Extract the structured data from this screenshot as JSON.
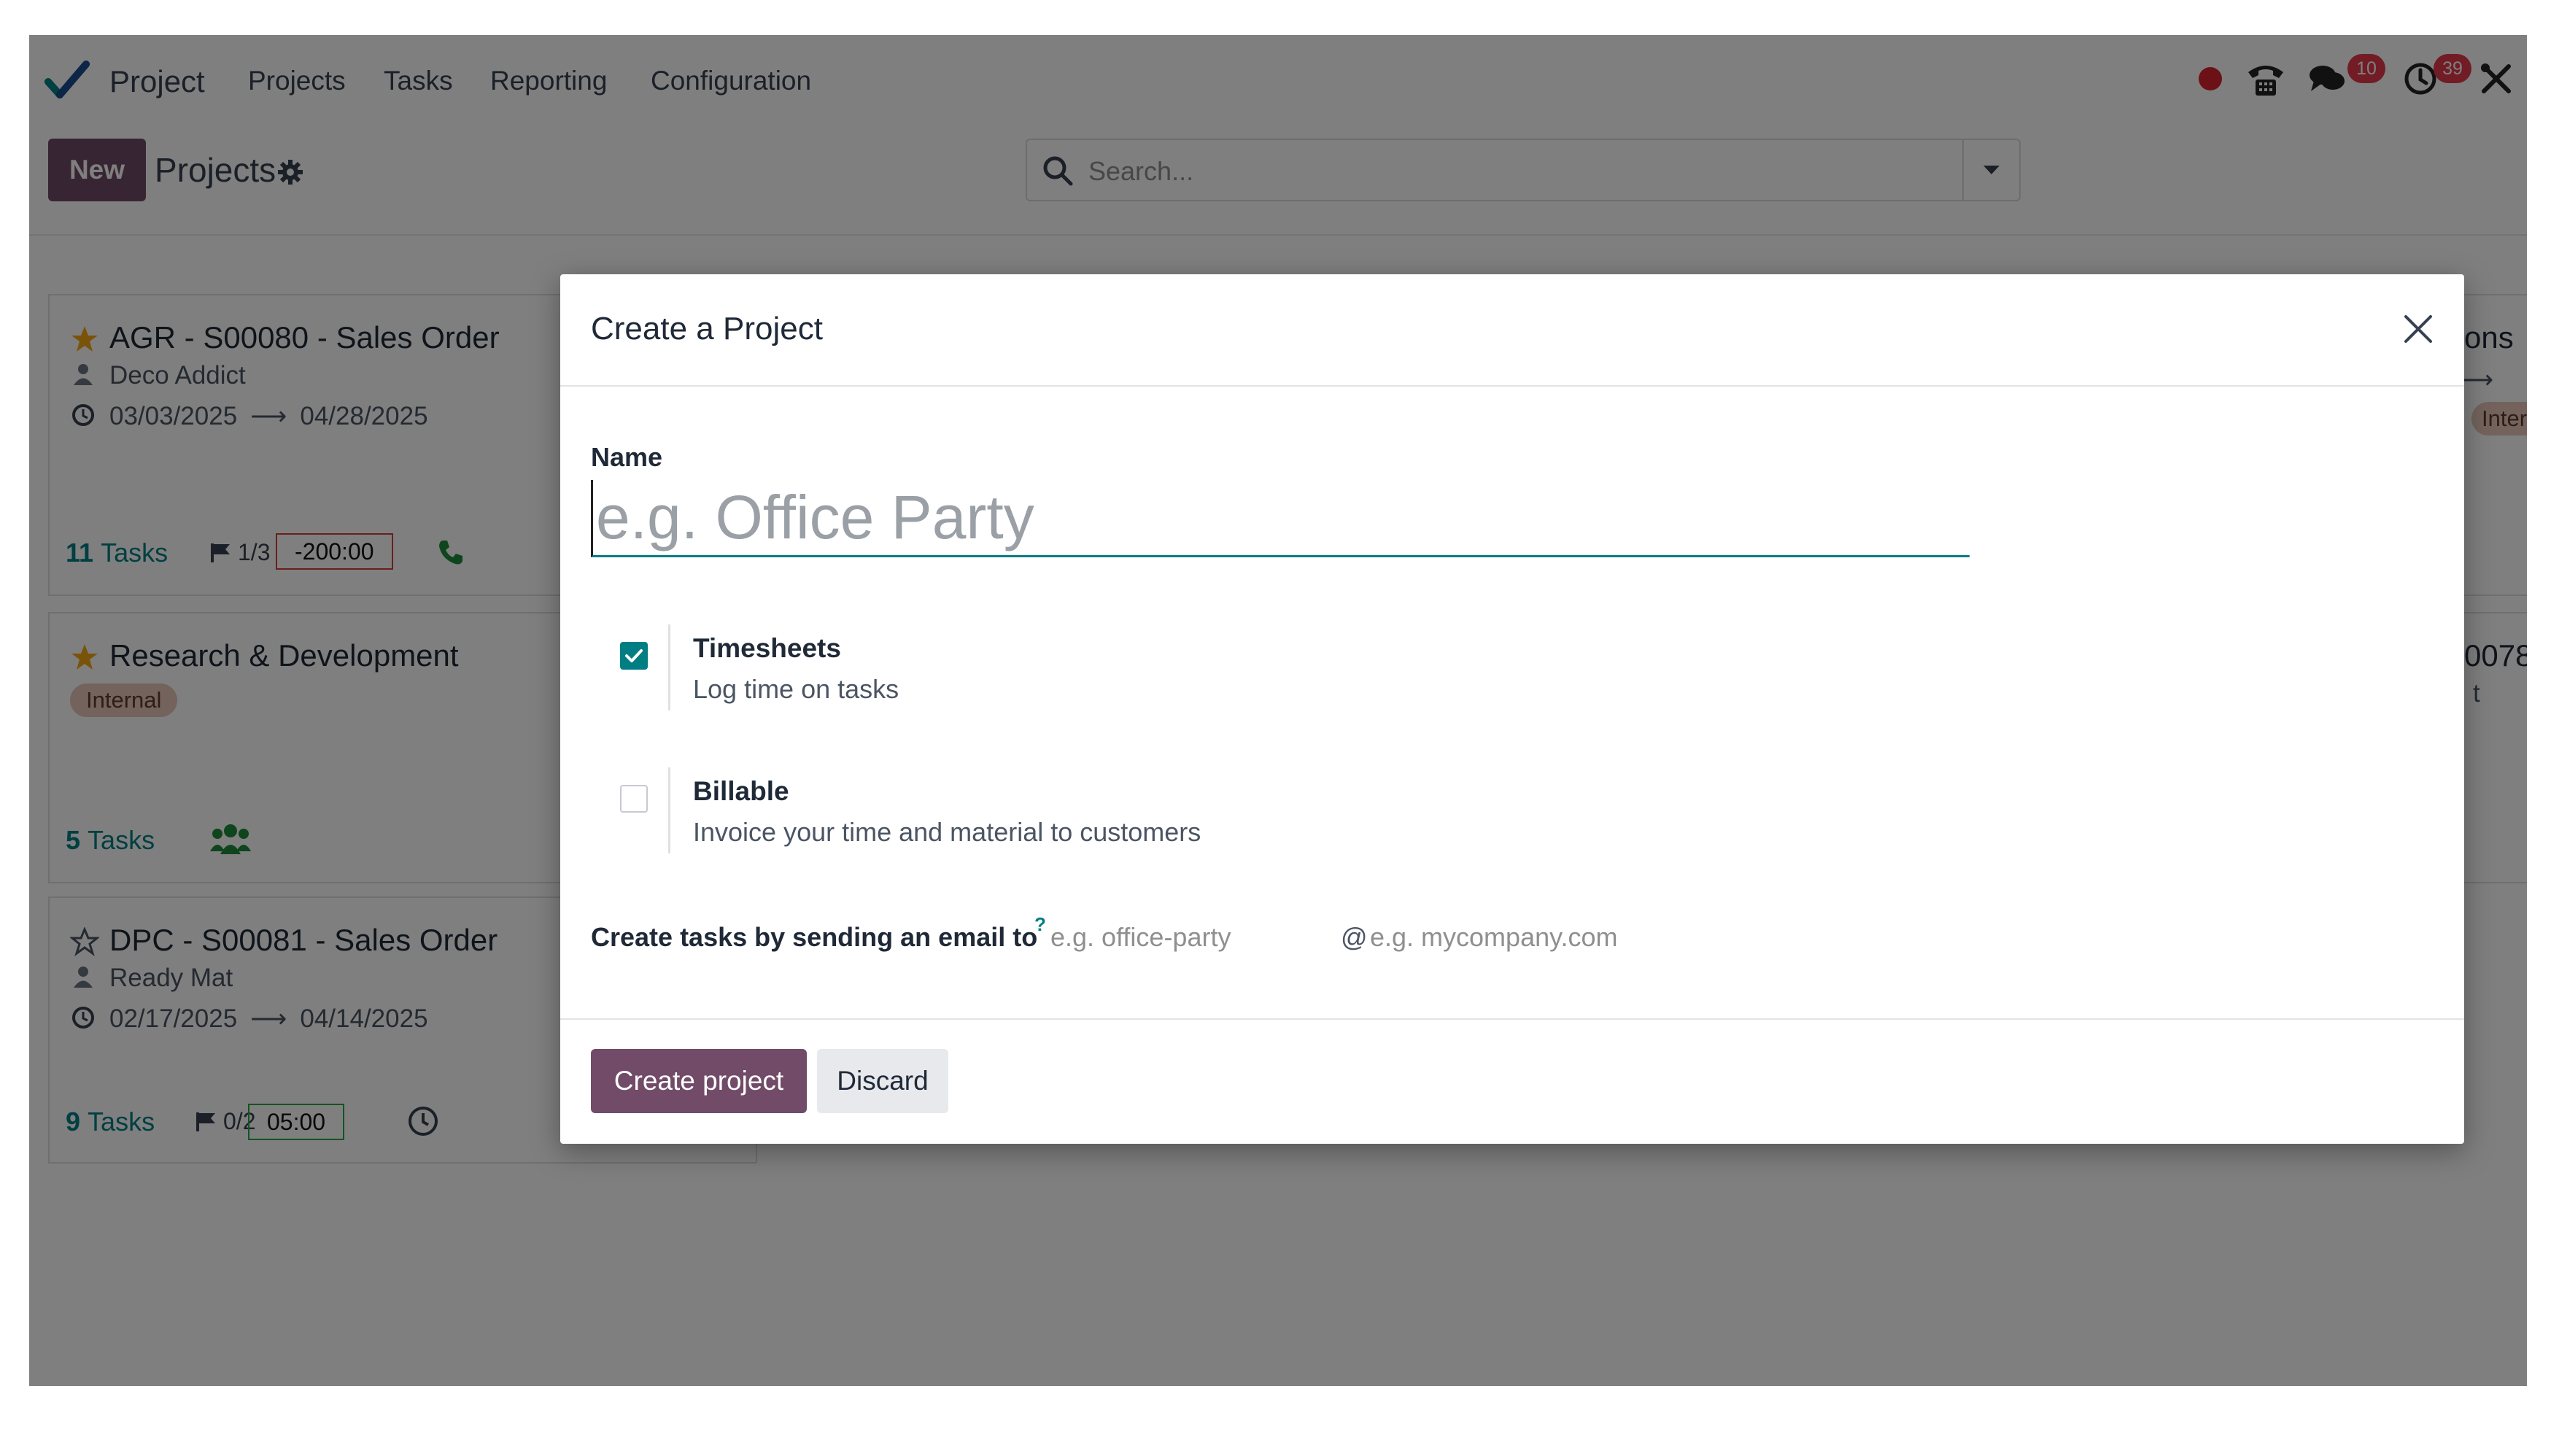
{
  "app": {
    "brand": "Project",
    "menu": [
      "Projects",
      "Tasks",
      "Reporting",
      "Configuration"
    ],
    "systray": {
      "messages_count": "10",
      "activities_count": "39"
    }
  },
  "control_panel": {
    "new_label": "New",
    "breadcrumb": "Projects",
    "search_placeholder": "Search..."
  },
  "kanban": {
    "cards": [
      {
        "title": "AGR - S00080 - Sales Order",
        "favorite": true,
        "customer": "Deco Addict",
        "date_start": "03/03/2025",
        "date_end": "04/28/2025",
        "task_count": "11",
        "task_label": "Tasks",
        "milestones": "1/3",
        "hours": "-200:00"
      },
      {
        "title": "Research & Development",
        "favorite": true,
        "tag": "Internal",
        "task_count": "5",
        "task_label": "Tasks"
      },
      {
        "title": "DPC - S00081 - Sales Order",
        "favorite": false,
        "customer": "Ready Mat",
        "date_start": "02/17/2025",
        "date_end": "04/14/2025",
        "task_count": "9",
        "task_label": "Tasks",
        "milestones": "0/2",
        "hours": "05:00"
      },
      {
        "title_fragment": "ons",
        "tag_fragment": "Intern"
      },
      {
        "title_fragment": "0078",
        "sub_fragment": "t"
      }
    ]
  },
  "modal": {
    "title": "Create a Project",
    "name_label": "Name",
    "name_placeholder": "e.g. Office Party",
    "options": [
      {
        "title": "Timesheets",
        "description": "Log time on tasks",
        "checked": true
      },
      {
        "title": "Billable",
        "description": "Invoice your time and material to customers",
        "checked": false
      }
    ],
    "email_label": "Create tasks by sending an email to",
    "email_help": "?",
    "email_alias_placeholder": "e.g. office-party",
    "email_at": "@",
    "email_domain_placeholder": "e.g. mycompany.com",
    "primary_button": "Create project",
    "secondary_button": "Discard"
  },
  "colors": {
    "brand": "#714b67",
    "accent": "#017e84",
    "star": "#f3a712",
    "hours_negative_border": "#d23f3a",
    "hours_positive_border": "#28a745",
    "phone_green": "#1f8a3a",
    "badge": "#e5384d"
  }
}
